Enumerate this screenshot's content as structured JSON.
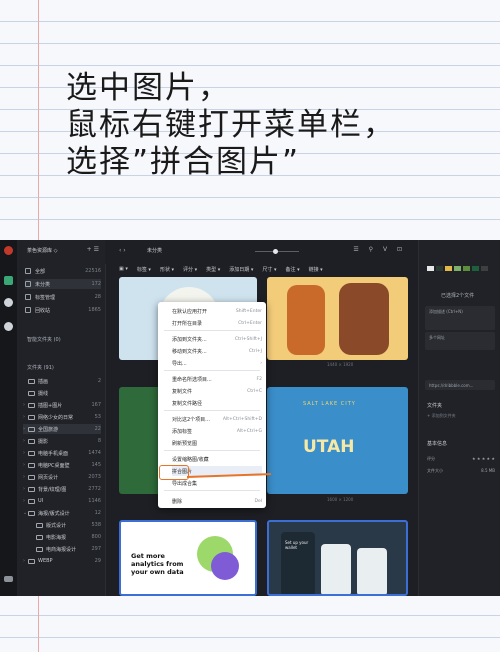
{
  "heading": {
    "line1": "选中图片，",
    "line2": "鼠标右键打开菜单栏，",
    "line3": "选择”拼合图片”"
  },
  "sidebar": {
    "library": "茶色资源库 ◇",
    "tools": "+ ☰",
    "items": [
      {
        "label": "全部",
        "count": "22516"
      },
      {
        "label": "未分类",
        "count": "172"
      },
      {
        "label": "标签管理",
        "count": "28"
      },
      {
        "label": "回收站",
        "count": "1865"
      }
    ],
    "smart_folders": "智能文件夹 (0)",
    "folders_header": "文件夹 (91)",
    "folders": [
      {
        "label": "插画",
        "count": "2",
        "arrow": ""
      },
      {
        "label": "摄线",
        "count": "",
        "arrow": ""
      },
      {
        "label": "插图+图片",
        "count": "167",
        "arrow": "›"
      },
      {
        "label": "网络少女的日常",
        "count": "53",
        "arrow": "›"
      },
      {
        "label": "全国旅游",
        "count": "22",
        "arrow": "›"
      },
      {
        "label": "摄影",
        "count": "8",
        "arrow": "›"
      },
      {
        "label": "电脑手机桌面",
        "count": "1474",
        "arrow": "›"
      },
      {
        "label": "电脑PC桌面壁",
        "count": "145",
        "arrow": "›"
      },
      {
        "label": "网页设计",
        "count": "2073",
        "arrow": "›"
      },
      {
        "label": "背景/纹理/图",
        "count": "2772",
        "arrow": "›"
      },
      {
        "label": "UI",
        "count": "1146",
        "arrow": "›"
      },
      {
        "label": "海报/版式设计",
        "count": "12",
        "arrow": "⌄"
      },
      {
        "label": "版式设计",
        "count": "538",
        "arrow": ""
      },
      {
        "label": "电影海报",
        "count": "800",
        "arrow": ""
      },
      {
        "label": "电商海报设计",
        "count": "297",
        "arrow": ""
      },
      {
        "label": "WEBP",
        "count": "29",
        "arrow": "›"
      }
    ]
  },
  "toolbar": {
    "nav": "‹  ›",
    "title": "未分类",
    "icons": "☰ ⚲ V ⊡",
    "filters": [
      "▣ ▾",
      "标签 ▾",
      "形状 ▾",
      "评分 ▾",
      "类型 ▾",
      "添加日期 ▾",
      "尺寸 ▾",
      "备注 ▾",
      "链接 ▾"
    ]
  },
  "grid": {
    "caption1": "1440 × 1920",
    "caption2": "1600 × 1200",
    "card_ad_text": "Get more analytics from your own data",
    "card_mobile_text": "Set up your wallet",
    "card_utah_text": "UTAH",
    "card_utah_sub": "SALT LAKE CITY"
  },
  "menu": {
    "items": [
      {
        "label": "在默认应用打开",
        "shortcut": "Shift+Enter"
      },
      {
        "label": "打开所在目录",
        "shortcut": "Ctrl+Enter"
      },
      {
        "label": "添加到文件夹...",
        "shortcut": "Ctrl+Shift+J"
      },
      {
        "label": "移动到文件夹...",
        "shortcut": "Ctrl+J"
      },
      {
        "label": "导出...",
        "shortcut": "›"
      },
      {
        "label": "重命名所选项目...",
        "shortcut": "F2"
      },
      {
        "label": "复制文件",
        "shortcut": "Ctrl+C"
      },
      {
        "label": "复制文件路径",
        "shortcut": ""
      },
      {
        "label": "对比这2个项目...",
        "shortcut": "Alt+Ctrl+Shift+D"
      },
      {
        "label": "添加标签",
        "shortcut": "Alt+Ctrl+G"
      },
      {
        "label": "刷新预览图",
        "shortcut": ""
      },
      {
        "label": "设置缩略图/收藏",
        "shortcut": ""
      },
      {
        "label": "拼合图片",
        "shortcut": ""
      },
      {
        "label": "导出成合集",
        "shortcut": ""
      },
      {
        "label": "删除",
        "shortcut": "Del"
      }
    ]
  },
  "rpanel": {
    "selected": "已选择2个文件",
    "notes_placeholder": "添加描述 (Ctrl+N)",
    "url_placeholder": "多个网址",
    "url_value": "https://dribbble.com...",
    "folder_label": "文件夹",
    "add_folder": "+ 添加到文件夹",
    "info_label": "基本信息",
    "rating_label": "评分",
    "rating_stars": "★ ★ ★ ★ ★",
    "size_label": "文件大小",
    "size_value": "8.5 MB"
  }
}
